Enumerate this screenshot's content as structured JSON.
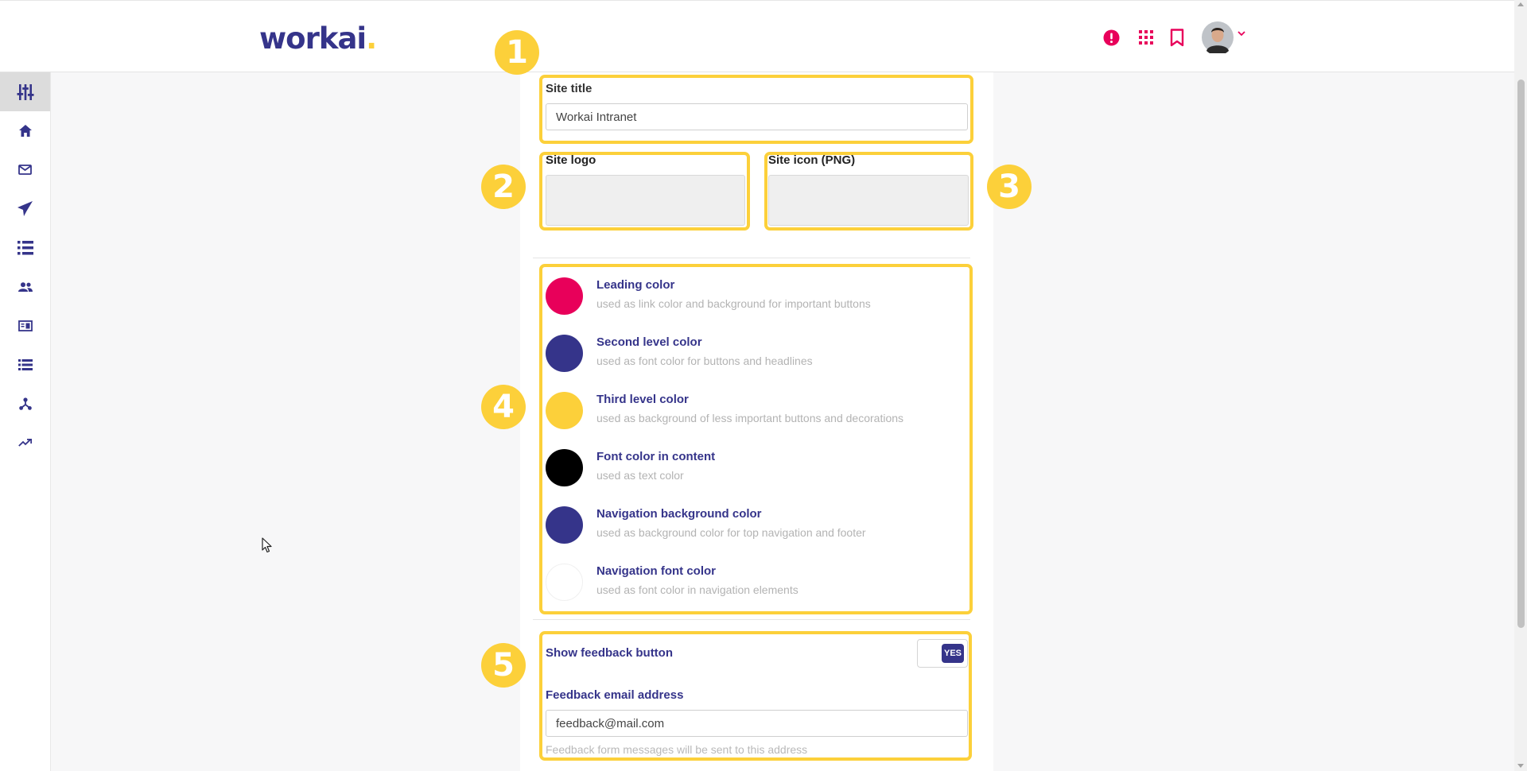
{
  "header": {
    "logo_text": "workai",
    "logo_dot": "."
  },
  "top_icons": [
    "alert-icon",
    "apps-grid-icon",
    "bookmark-icon",
    "user-avatar",
    "chevron-down-icon"
  ],
  "sidebar": {
    "items": [
      {
        "name": "settings-sliders-icon",
        "active": true
      },
      {
        "name": "home-icon"
      },
      {
        "name": "mail-icon"
      },
      {
        "name": "send-icon"
      },
      {
        "name": "list-icon"
      },
      {
        "name": "people-icon"
      },
      {
        "name": "news-icon"
      },
      {
        "name": "list-view-icon"
      },
      {
        "name": "hierarchy-icon"
      },
      {
        "name": "trending-icon"
      }
    ]
  },
  "form": {
    "site_title": {
      "label": "Site title",
      "value": "Workai Intranet"
    },
    "site_logo": {
      "label": "Site logo"
    },
    "site_icon": {
      "label": "Site icon (PNG)"
    },
    "colors": [
      {
        "title": "Leading color",
        "description": "used as link color and background for important buttons",
        "color": "#e8005a"
      },
      {
        "title": "Second level color",
        "description": "used as font color for buttons and headlines",
        "color": "#35348a"
      },
      {
        "title": "Third level color",
        "description": "used as background of less important buttons and decorations",
        "color": "#fcd03a"
      },
      {
        "title": "Font color in content",
        "description": "used as text color",
        "color": "#000000"
      },
      {
        "title": "Navigation background color",
        "description": "used as background color for top navigation and footer",
        "color": "#35348a"
      },
      {
        "title": "Navigation font color",
        "description": "used as font color in navigation elements",
        "color": "#ffffff"
      }
    ],
    "feedback": {
      "toggle_label": "Show feedback button",
      "toggle_state": "YES",
      "email_label": "Feedback email address",
      "email_value": "feedback@mail.com",
      "email_hint": "Feedback form messages will be sent to this address"
    }
  },
  "annotations": [
    "1",
    "2",
    "3",
    "4",
    "5"
  ],
  "colors": {
    "brand_primary": "#35348a",
    "brand_accent": "#e8005a",
    "highlight": "#fcd03a"
  }
}
